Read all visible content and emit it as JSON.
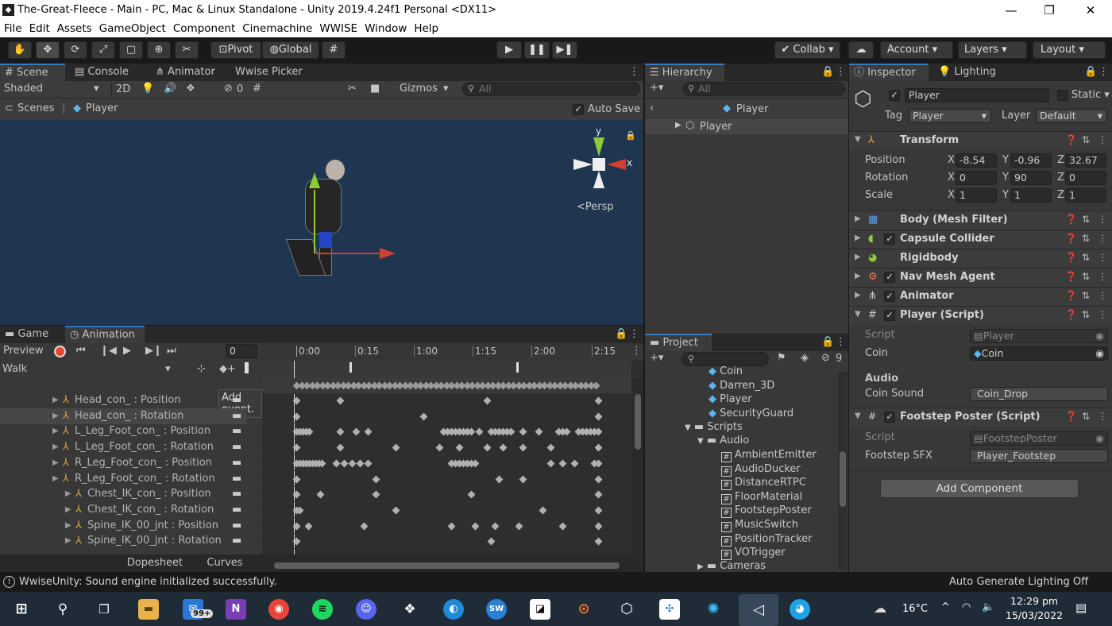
{
  "window": {
    "title": "The-Great-Fleece - Main - PC, Mac & Linux Standalone - Unity 2019.4.24f1 Personal <DX11>",
    "minimize": "—",
    "maximize": "❐",
    "close": "✕"
  },
  "menu": [
    "File",
    "Edit",
    "Assets",
    "GameObject",
    "Component",
    "Cinemachine",
    "WWISE",
    "Window",
    "Help"
  ],
  "toolbar": {
    "pivot": "Pivot",
    "global": "Global",
    "collab": "Collab",
    "account": "Account",
    "layers": "Layers",
    "layout": "Layout"
  },
  "scene": {
    "tabs": [
      "Scene",
      "Console",
      "Animator",
      "Wwise Picker"
    ],
    "shading": "Shaded",
    "mode2d": "2D",
    "hidden_count": "0",
    "gizmos": "Gizmos",
    "search_placeholder": "All",
    "breadcrumb_root": "Scenes",
    "breadcrumb_current": "Player",
    "autosave": "Auto Save",
    "persp": "Persp",
    "axis_y": "y",
    "axis_x": "x"
  },
  "hierarchy": {
    "tab": "Hierarchy",
    "search_placeholder": "All",
    "prefab_title": "Player",
    "items": [
      "Player"
    ]
  },
  "inspector": {
    "tabs": [
      "Inspector",
      "Lighting"
    ],
    "object_name": "Player",
    "static_label": "Static",
    "tag_label": "Tag",
    "tag_value": "Player",
    "layer_label": "Layer",
    "layer_value": "Default",
    "transform": {
      "name": "Transform",
      "position_label": "Position",
      "rotation_label": "Rotation",
      "scale_label": "Scale",
      "position": [
        "-8.54",
        "-0.96",
        "32.67"
      ],
      "rotation": [
        "0",
        "90",
        "0"
      ],
      "scale": [
        "1",
        "1",
        "1"
      ],
      "axes": [
        "X",
        "Y",
        "Z"
      ]
    },
    "components": [
      "Body (Mesh Filter)",
      "Capsule Collider",
      "Rigidbody",
      "Nav Mesh Agent",
      "Animator",
      "Player (Script)"
    ],
    "player_script": {
      "script_label": "Script",
      "script_value": "Player",
      "coin_label": "Coin",
      "coin_value": "Coin",
      "audio_header": "Audio",
      "coin_sound_label": "Coin Sound",
      "coin_sound_value": "Coin_Drop"
    },
    "footstep": {
      "name": "Footstep Poster (Script)",
      "script_label": "Script",
      "script_value": "FootstepPoster",
      "sfx_label": "Footstep SFX",
      "sfx_value": "Player_Footstep"
    },
    "add_component": "Add Component"
  },
  "animation": {
    "tabs": [
      "Game",
      "Animation"
    ],
    "preview": "Preview",
    "frame": "0",
    "clip": "Walk",
    "tooltip": "Add event.",
    "times": [
      "0:00",
      "0:15",
      "1:00",
      "1:15",
      "2:00",
      "2:15"
    ],
    "dopesheet": "Dopesheet",
    "curves": "Curves",
    "properties": [
      "Head_con_ : Position",
      "Head_con_ : Rotation",
      "L_Leg_Foot_con_ : Position",
      "L_Leg_Foot_con_ : Rotation",
      "R_Leg_Foot_con_ : Position",
      "R_Leg_Foot_con_ : Rotation",
      "Chest_IK_con_ : Position",
      "Chest_IK_con_ : Rotation",
      "Spine_IK_00_jnt : Position",
      "Spine_IK_00_jnt : Rotation"
    ]
  },
  "project": {
    "tab": "Project",
    "hidden_count": "9",
    "items": [
      "Coin",
      "Darren_3D",
      "Player",
      "SecurityGuard"
    ],
    "scripts_folder": "Scripts",
    "audio_folder": "Audio",
    "scripts": [
      "AmbientEmitter",
      "AudioDucker",
      "DistanceRTPC",
      "FloorMaterial",
      "FootstepPoster",
      "MusicSwitch",
      "PositionTracker",
      "VOTrigger"
    ],
    "cameras_folder": "Cameras"
  },
  "status": {
    "message": "WwiseUnity: Sound engine initialized successfully.",
    "right": "Auto Generate Lighting Off"
  },
  "taskbar": {
    "mail_badge": "99+",
    "weather": "16°C",
    "time": "12:29 pm",
    "date": "15/03/2022"
  }
}
